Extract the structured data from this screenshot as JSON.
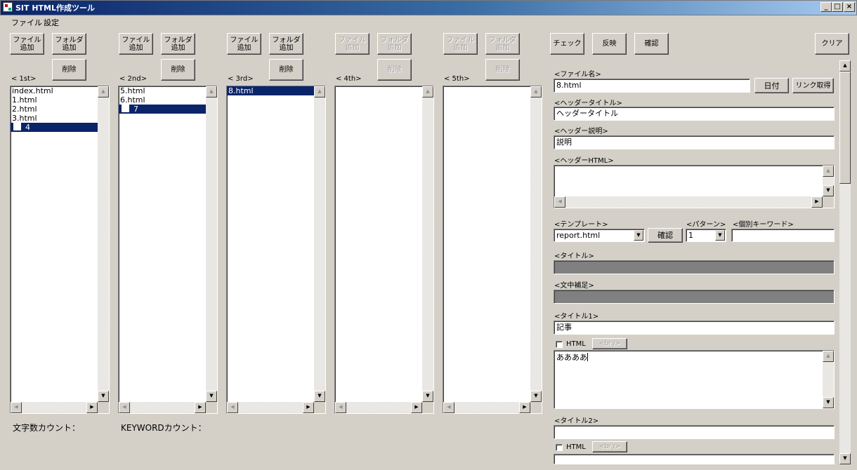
{
  "window": {
    "title": "SIT HTML作成ツール",
    "min_glyph": "_",
    "max_glyph": "□",
    "close_glyph": "×"
  },
  "menu": [
    "ファイル",
    "設定"
  ],
  "columns": [
    {
      "header": "< 1st>",
      "add_file": "ファイル\n追加",
      "add_folder": "フォルダ\n追加",
      "delete": "削除",
      "items": [
        "index.html",
        "1.html",
        "2.html",
        "3.html"
      ],
      "folder_item": "4"
    },
    {
      "header": "< 2nd>",
      "add_file": "ファイル\n追加",
      "add_folder": "フォルダ\n追加",
      "delete": "削除",
      "items": [
        "5.html",
        "6.html"
      ],
      "folder_item": "7"
    },
    {
      "header": "< 3rd>",
      "add_file": "ファイル\n追加",
      "add_folder": "フォルダ\n追加",
      "delete": "削除",
      "selected_item": "8.html"
    },
    {
      "header": "< 4th>",
      "add_file": "ファイル\n追加",
      "add_folder": "フォルダ\n追加",
      "delete": "削除"
    },
    {
      "header": "< 5th>",
      "add_file": "ファイル\n追加",
      "add_folder": "フォルダ\n追加",
      "delete": "削除"
    }
  ],
  "counts": {
    "char_count_label": "文字数カウント：",
    "keyword_count_label": "KEYWORDカウント："
  },
  "toolbar": {
    "check": "チェック",
    "apply": "反映",
    "confirm": "確認",
    "clear": "クリア"
  },
  "form": {
    "filename_label": "<ファイル名>",
    "filename_value": "8.html",
    "date_button": "日付",
    "link_button": "リンク取得",
    "header_title_label": "<ヘッダータイトル>",
    "header_title_value": "ヘッダータイトル",
    "header_desc_label": "<ヘッダー説明>",
    "header_desc_value": "説明",
    "header_html_label": "<ヘッダーHTML>",
    "template_label": "<テンプレート>",
    "template_value": "report.html",
    "template_confirm": "確認",
    "pattern_label": "<パターン>",
    "pattern_value": "1",
    "keyword_label": "<個別キーワード>",
    "title_label": "<タイトル>",
    "subtext_label": "<文中補足>",
    "title1_label": "<タイトル1>",
    "title1_value": "記事",
    "html_checkbox_label": "HTML",
    "br_button": "<br />",
    "body1_value": "ああああ",
    "title2_label": "<タイトル2>",
    "html_checkbox2_label": "HTML",
    "br_button2": "<br />"
  }
}
